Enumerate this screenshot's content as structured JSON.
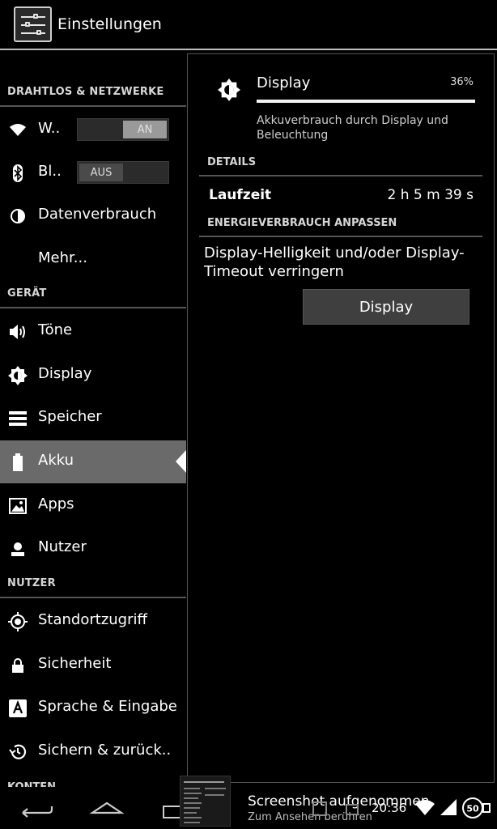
{
  "app": {
    "title": "Einstellungen"
  },
  "sections": {
    "wireless": "DRAHTLOS & NETZWERKE",
    "device": "GERÄT",
    "personal": "NUTZER",
    "accounts": "KONTEN"
  },
  "items": {
    "wifi": {
      "label": "W..",
      "toggle": "AN"
    },
    "bluetooth": {
      "label": "Bl..",
      "toggle": "AUS"
    },
    "data": "Datenverbrauch",
    "more": "Mehr...",
    "sound": "Töne",
    "display": "Display",
    "storage": "Speicher",
    "battery": "Akku",
    "apps": "Apps",
    "users": "Nutzer",
    "location": "Standortzugriff",
    "security": "Sicherheit",
    "language": "Sprache & Eingabe",
    "backup": "Sichern & zurück.."
  },
  "detail": {
    "title": "Display",
    "percent_label": "36%",
    "percent": 0.36,
    "description": "Akkuverbrauch durch Display und Beleuchtung",
    "details_header": "DETAILS",
    "runtime_label": "Laufzeit",
    "runtime_value": "2 h 5 m 39 s",
    "adjust_header": "ENERGIEVERBRAUCH ANPASSEN",
    "tip": "Display-Helligkeit und/oder Display-Timeout verringern",
    "button": "Display"
  },
  "statusbar": {
    "notif_title": "Screenshot aufgenommen",
    "notif_sub": "Zum Ansehen berühren",
    "time": "20:36",
    "battery_level": "50"
  },
  "colors": {
    "selected_bg": "#6a6a6a",
    "divider": "#555555"
  }
}
